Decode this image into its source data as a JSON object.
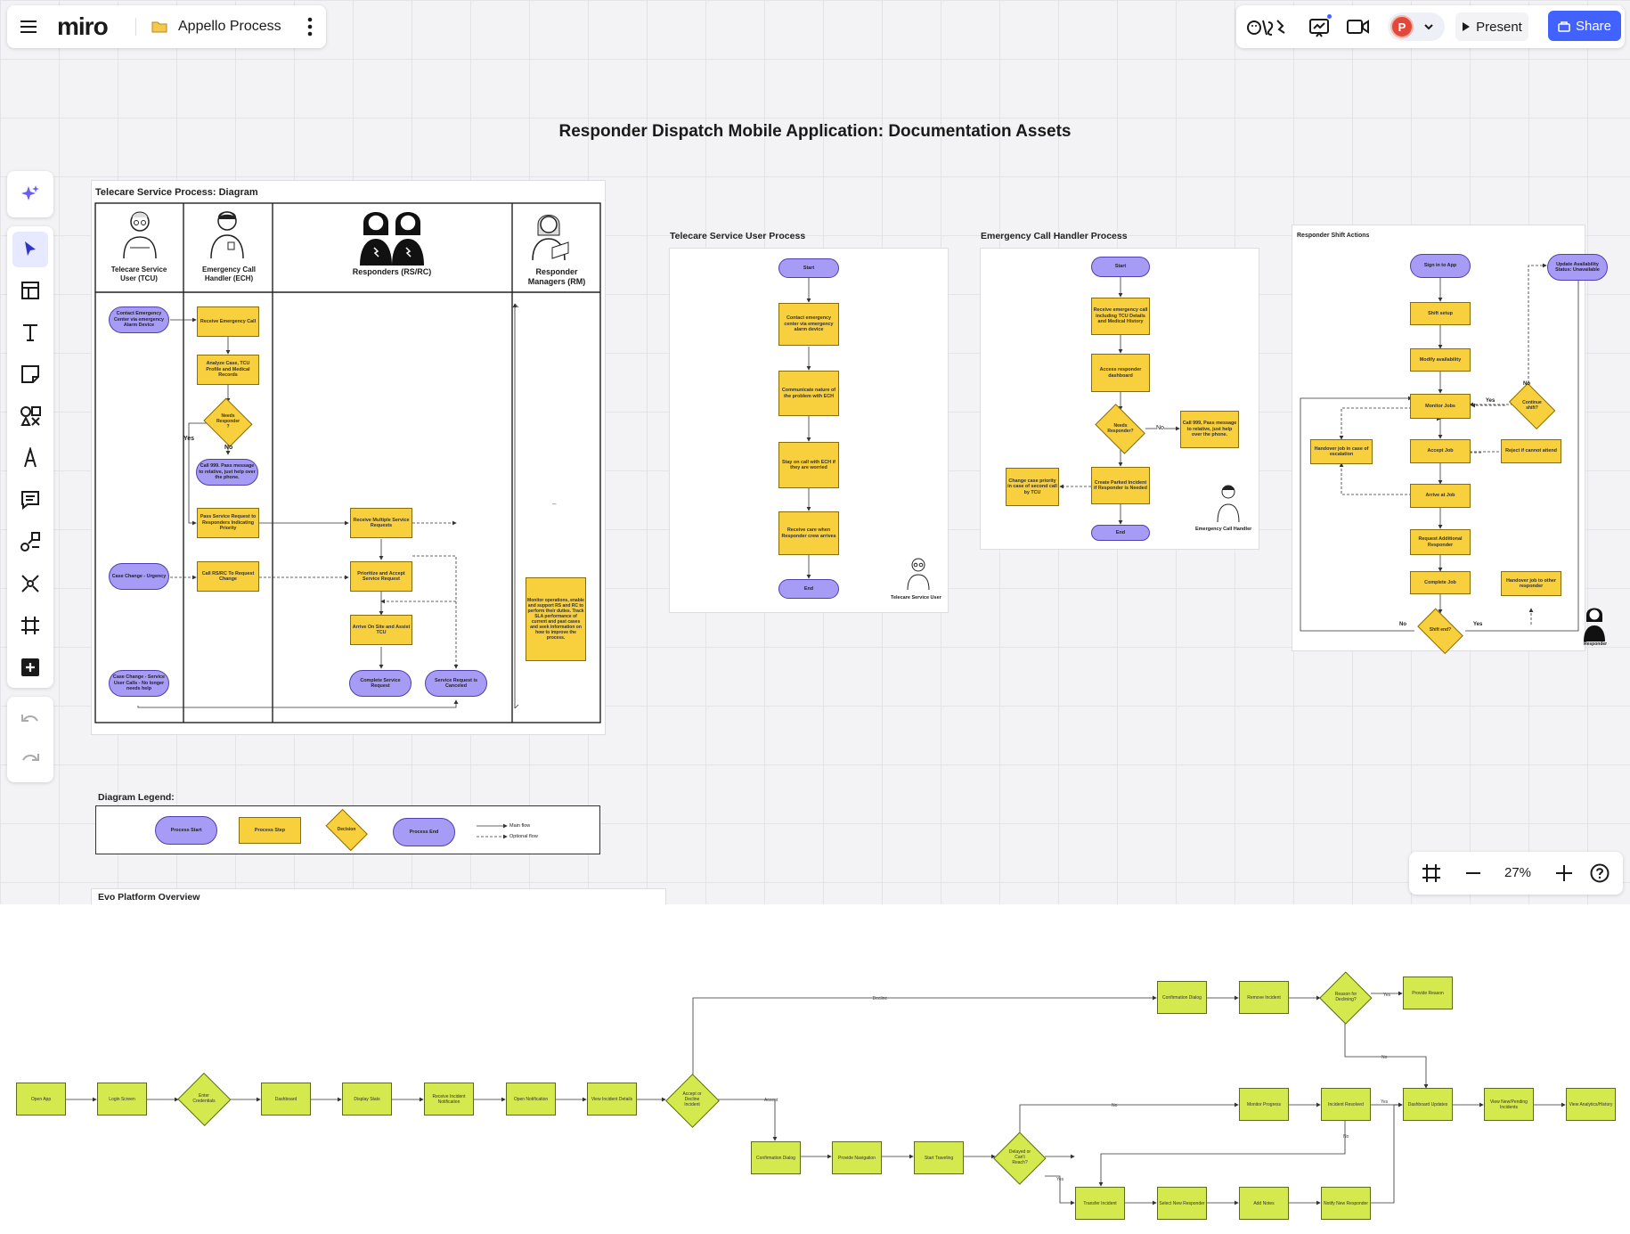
{
  "app": {
    "logo": "miro",
    "board_name": "Appello Process",
    "present_label": "Present",
    "share_label": "Share",
    "avatar_initial": "P",
    "zoom": "27%"
  },
  "board": {
    "title": "Responder Dispatch Mobile Application: Documentation Assets",
    "swimlane": {
      "label": "Telecare Service Process: Diagram",
      "lanes": [
        "Telecare Service User (TCU)",
        "Emergency Call Handler (ECH)",
        "Responders (RS/RC)",
        "Responder Managers (RM)"
      ],
      "steps": {
        "s1": "Contact Emergency Center via emergency Alarm Device",
        "s2": "Receive Emergency Call",
        "s3": "Analyze Case, TCU Profile and Medical Records",
        "s4": "Needs Responder ?",
        "s5": "Call 999. Pass message to relative, just help over the phone.",
        "s6": "Pass Service Request to Responders Indicating Priority",
        "s7": "Receive Multiple Service Requests",
        "s8": "Case Change - Urgency",
        "s9": "Call RS/RC To Request Change",
        "s10": "Prioritize and Accept Service Request",
        "s11": "Arrive On Site and Assist TCU",
        "s12": "Monitor operations, enable and support RS and RC to perform their duties. Track SLA performance of current and past cases and seek information on how to improve the process.",
        "s13": "Case Change - Service User Calls - No longer needs help",
        "s14": "Complete Service Request",
        "s15": "Service Request is Canceled",
        "yes": "Yes",
        "no": "No",
        "dash": "–"
      }
    },
    "tsu": {
      "label": "Telecare Service User Process",
      "steps": [
        "Start",
        "Contact emergency center via emergency alarm device",
        "Communicate nature of the problem with ECH",
        "Stay on call with ECH if they are worried",
        "Receive care when Responder crew arrives",
        "End"
      ],
      "caption": "Telecare Service User"
    },
    "ech": {
      "label": "Emergency Call Handler Process",
      "steps": [
        "Start",
        "Receive emergency call including TCU Details and Medical History",
        "Access responder dashboard",
        "Needs Responder?",
        "Call 999, Pass message to relative, just help over the phone.",
        "Create Parked Incident if Responder is Needed",
        "Change case priority in case of second call by TCU",
        "End"
      ],
      "no": "No",
      "caption": "Emergency Call Handler"
    },
    "rsa": {
      "label": "Responder Shift Actions",
      "steps": [
        "Sign in to App",
        "Shift setup",
        "Modify availability",
        "Monitor Jobs",
        "Continue shift?",
        "Update Availability Status: Unavailable",
        "Handover job in case of escalation",
        "Accept Job",
        "Reject if cannot attend",
        "Arrive at Job",
        "Request Additional Responder",
        "Complete Job",
        "Handover job to other responder",
        "Shift end?"
      ],
      "yes": "Yes",
      "no": "No",
      "caption": "Responder"
    },
    "legend": {
      "label": "Diagram Legend:",
      "items": [
        "Process Start",
        "Process Step",
        "Decision",
        "Process End"
      ],
      "main_flow": "Main flow",
      "optional_flow": "Optional flow"
    },
    "evo_label": "Evo Platform Overview"
  },
  "evo": {
    "main": [
      "Open App",
      "Login Screen",
      "Enter Credentials",
      "Dashboard",
      "Display Stats",
      "Receive Incident Notification",
      "Open Notification",
      "View Incident Details",
      "Accept or Decline Incident"
    ],
    "top": [
      "Confirmation Dialog",
      "Remove Incident",
      "Reason for Declining?",
      "Provide Reason"
    ],
    "mid": [
      "Confirmation Dialog",
      "Provide Navigation",
      "Start Traveling",
      "Delayed or Can't Reach?"
    ],
    "right": [
      "Monitor Progress",
      "Incident Resolved",
      "Dashboard Updates",
      "View New/Pending Incidents",
      "View Analytics/History"
    ],
    "low": [
      "Transfer Incident",
      "Select New Responder",
      "Add Notes",
      "Notify New Responder"
    ],
    "labels": {
      "decline": "Decline",
      "accept": "Accept",
      "yes": "Yes",
      "no": "No"
    }
  }
}
